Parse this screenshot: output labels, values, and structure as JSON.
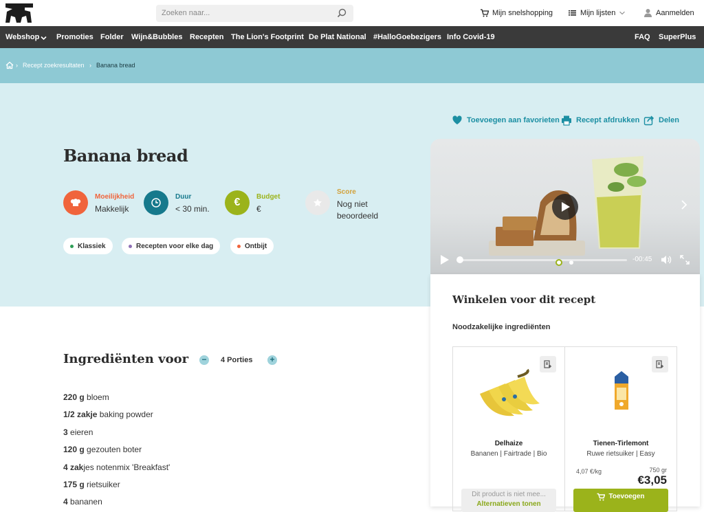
{
  "header": {
    "search_placeholder": "Zoeken naar...",
    "quick_shopping": "Mijn snelshopping",
    "my_lists": "Mijn lijsten",
    "login": "Aanmelden"
  },
  "nav": {
    "items": [
      "Webshop",
      "Promoties",
      "Folder",
      "Wijn&Bubbles",
      "Recepten",
      "The Lion's Footprint",
      "De Plat National",
      "#HalloGoebezigers",
      "Info Covid-19"
    ],
    "right": [
      "FAQ",
      "SuperPlus"
    ]
  },
  "breadcrumb": [
    "Recept zoekresultaten",
    "Banana bread"
  ],
  "recipe": {
    "title": "Banana bread",
    "meta": [
      {
        "label": "Moeilijkheid",
        "value": "Makkelijk",
        "color": "#f0643c",
        "icon": "chef-hat-icon"
      },
      {
        "label": "Duur",
        "value": "< 30 min.",
        "color": "#16798c",
        "icon": "clock-icon"
      },
      {
        "label": "Budget",
        "value": "€",
        "color": "#9bb31b",
        "icon": "euro-icon"
      },
      {
        "label": "Score",
        "value": "Nog niet beoordeeld",
        "color": "#d2a13a",
        "icon": "star-icon"
      }
    ],
    "tags": [
      {
        "label": "Klassiek",
        "color": "#2e9e56"
      },
      {
        "label": "Recepten voor elke dag",
        "color": "#8e6fb5"
      },
      {
        "label": "Ontbijt",
        "color": "#f0643c"
      }
    ],
    "actions": [
      "Toevoegen aan favorieten",
      "Recept afdrukken",
      "Delen"
    ]
  },
  "video": {
    "time": "-00:45",
    "progress": 0.0
  },
  "shop": {
    "title": "Winkelen voor dit recept",
    "subtitle": "Noodzakelijke ingrediënten",
    "products": [
      {
        "brand": "Delhaize",
        "desc": "Bananen | Fairtrade | Bio",
        "unavailable": "Dit product is niet mee...",
        "alt": "Alternatieven tonen"
      },
      {
        "brand": "Tienen-Tirlemont",
        "desc": "Ruwe rietsuiker | Easy",
        "unit_price": "4,07 €/kg",
        "weight": "750 gr",
        "price": "€3,05",
        "add": "Toevoegen"
      }
    ]
  },
  "ingredients": {
    "title": "Ingrediënten voor",
    "portions": "4 Porties",
    "items": [
      {
        "qty": "220 g",
        "name": "bloem"
      },
      {
        "qty": "1/2 zakje",
        "name": "baking powder"
      },
      {
        "qty": "3",
        "name": "eieren"
      },
      {
        "qty": "120 g",
        "name": "gezouten boter"
      },
      {
        "qty": "4 zak",
        "name": "jes notenmix 'Breakfast'"
      },
      {
        "qty": "175 g",
        "name": "rietsuiker"
      },
      {
        "qty": "4",
        "name": "bananen"
      }
    ]
  }
}
